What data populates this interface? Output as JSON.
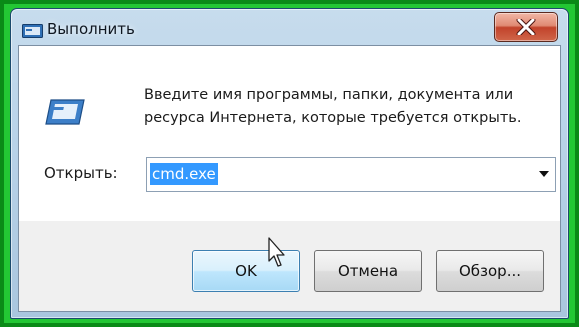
{
  "window": {
    "title": "Выполнить",
    "title_icon": "run-icon",
    "close_icon": "close-icon"
  },
  "dialog": {
    "icon": "run-program-icon",
    "description_line1": "Введите имя программы, папки, документа или",
    "description_line2": "ресурса Интернета, которые требуется открыть.",
    "open_label": "Открыть:",
    "open_value": "cmd.exe"
  },
  "buttons": {
    "ok": "OK",
    "cancel": "Отмена",
    "browse": "Обзор..."
  },
  "colors": {
    "frame_green": "#23c734",
    "selection": "#3399ff",
    "close_red": "#c2432b"
  }
}
